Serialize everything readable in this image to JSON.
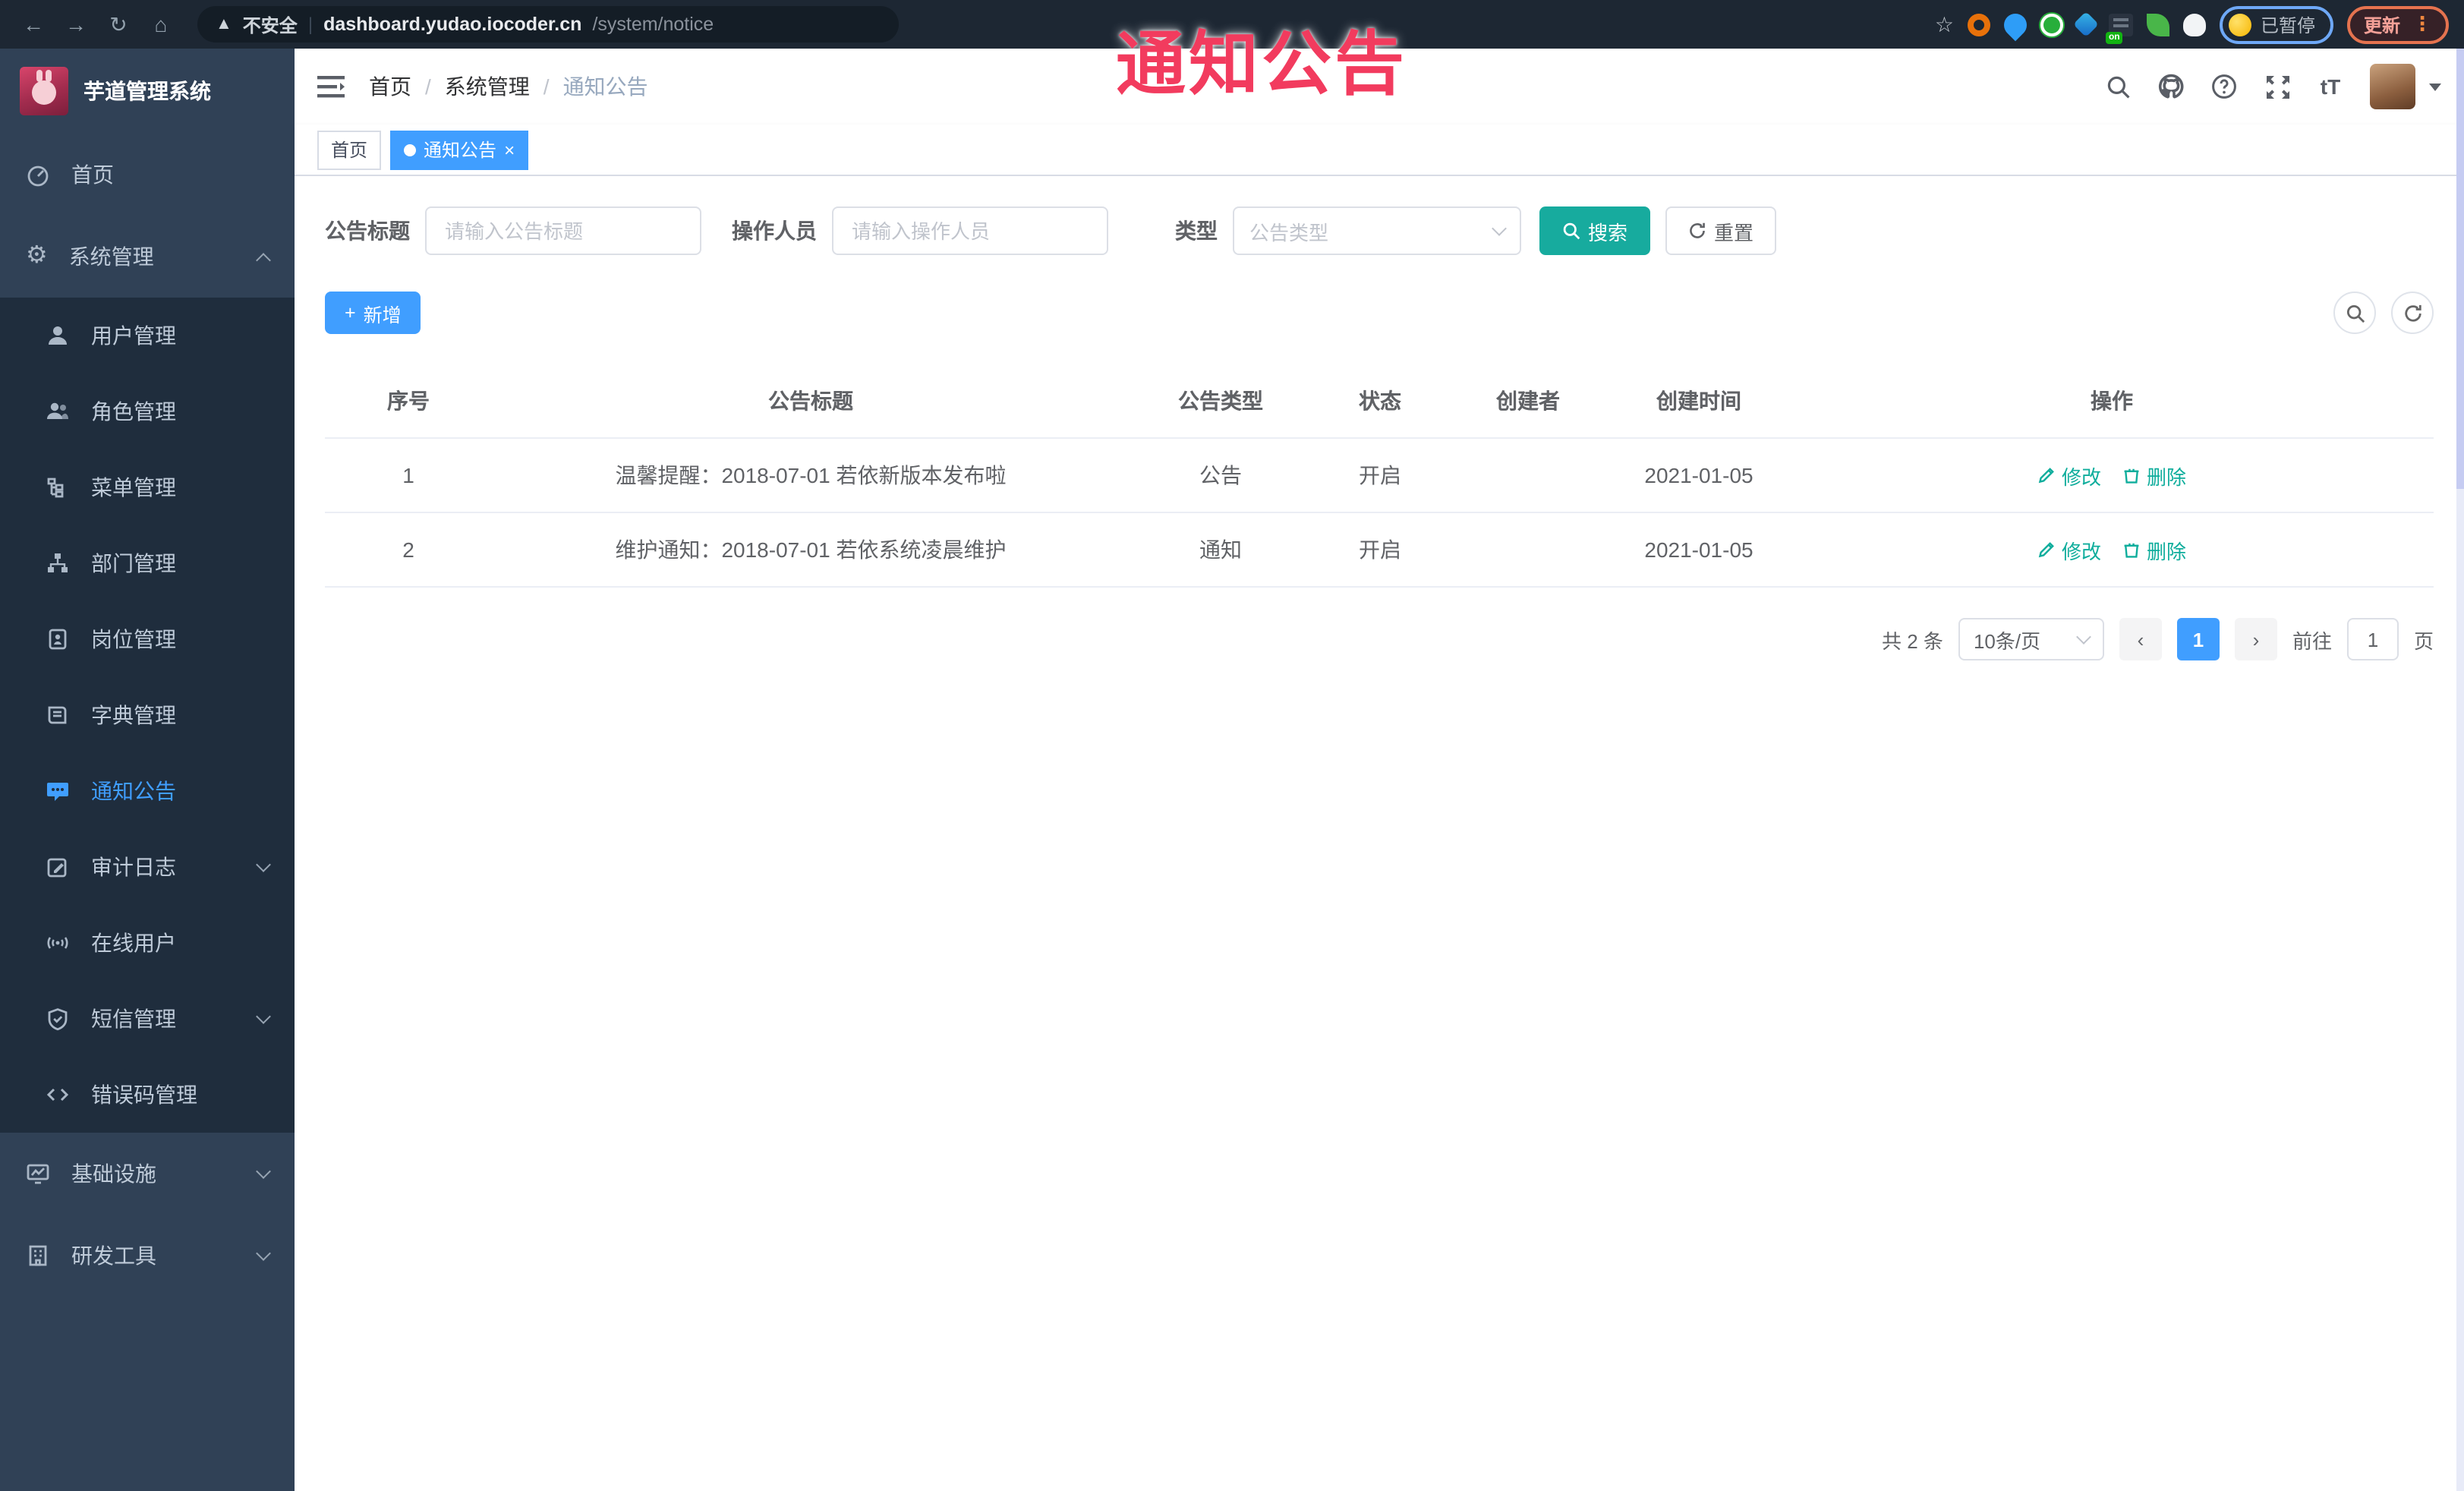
{
  "browser": {
    "security_label": "不安全",
    "url_domain": "dashboard.yudao.iocoder.cn",
    "url_path": "/system/notice",
    "extension_on_badge": "on",
    "paused_label": "已暂停",
    "update_label": "更新"
  },
  "overlay": {
    "text": "通知公告"
  },
  "sidebar": {
    "title": "芋道管理系统",
    "home": "首页",
    "system": "系统管理",
    "system_children": [
      {
        "label": "用户管理"
      },
      {
        "label": "角色管理"
      },
      {
        "label": "菜单管理"
      },
      {
        "label": "部门管理"
      },
      {
        "label": "岗位管理"
      },
      {
        "label": "字典管理"
      },
      {
        "label": "通知公告",
        "active": true
      },
      {
        "label": "审计日志",
        "collapsible": true
      },
      {
        "label": "在线用户"
      },
      {
        "label": "短信管理",
        "collapsible": true
      },
      {
        "label": "错误码管理"
      }
    ],
    "infra": "基础设施",
    "dev": "研发工具"
  },
  "header": {
    "breadcrumb": {
      "home": "首页",
      "section": "系统管理",
      "current": "通知公告"
    }
  },
  "tabs": {
    "home": "首页",
    "current": "通知公告"
  },
  "filters": {
    "title_label": "公告标题",
    "title_placeholder": "请输入公告标题",
    "operator_label": "操作人员",
    "operator_placeholder": "请输入操作人员",
    "type_label": "类型",
    "type_placeholder": "公告类型",
    "search_label": "搜索",
    "reset_label": "重置"
  },
  "toolbar": {
    "add_label": "新增"
  },
  "table": {
    "columns": [
      "序号",
      "公告标题",
      "公告类型",
      "状态",
      "创建者",
      "创建时间",
      "操作"
    ],
    "edit_label": "修改",
    "delete_label": "删除",
    "rows": [
      {
        "index": "1",
        "title": "温馨提醒：2018-07-01 若依新版本发布啦",
        "type": "公告",
        "status": "开启",
        "creator": "",
        "created_at": "2021-01-05"
      },
      {
        "index": "2",
        "title": "维护通知：2018-07-01 若依系统凌晨维护",
        "type": "通知",
        "status": "开启",
        "creator": "",
        "created_at": "2021-01-05"
      }
    ]
  },
  "pagination": {
    "total_text": "共 2 条",
    "page_size": "10条/页",
    "current_page": "1",
    "goto_label": "前往",
    "goto_value": "1",
    "page_suffix": "页"
  },
  "colors": {
    "accent_blue": "#409EFF",
    "teal_button": "#17ab9e",
    "action_link": "#0fad9c",
    "sidebar_bg": "#304156",
    "submenu_bg": "#1f2d3d",
    "overlay_red": "#f23b5e",
    "chrome_bg": "#1d2733"
  }
}
